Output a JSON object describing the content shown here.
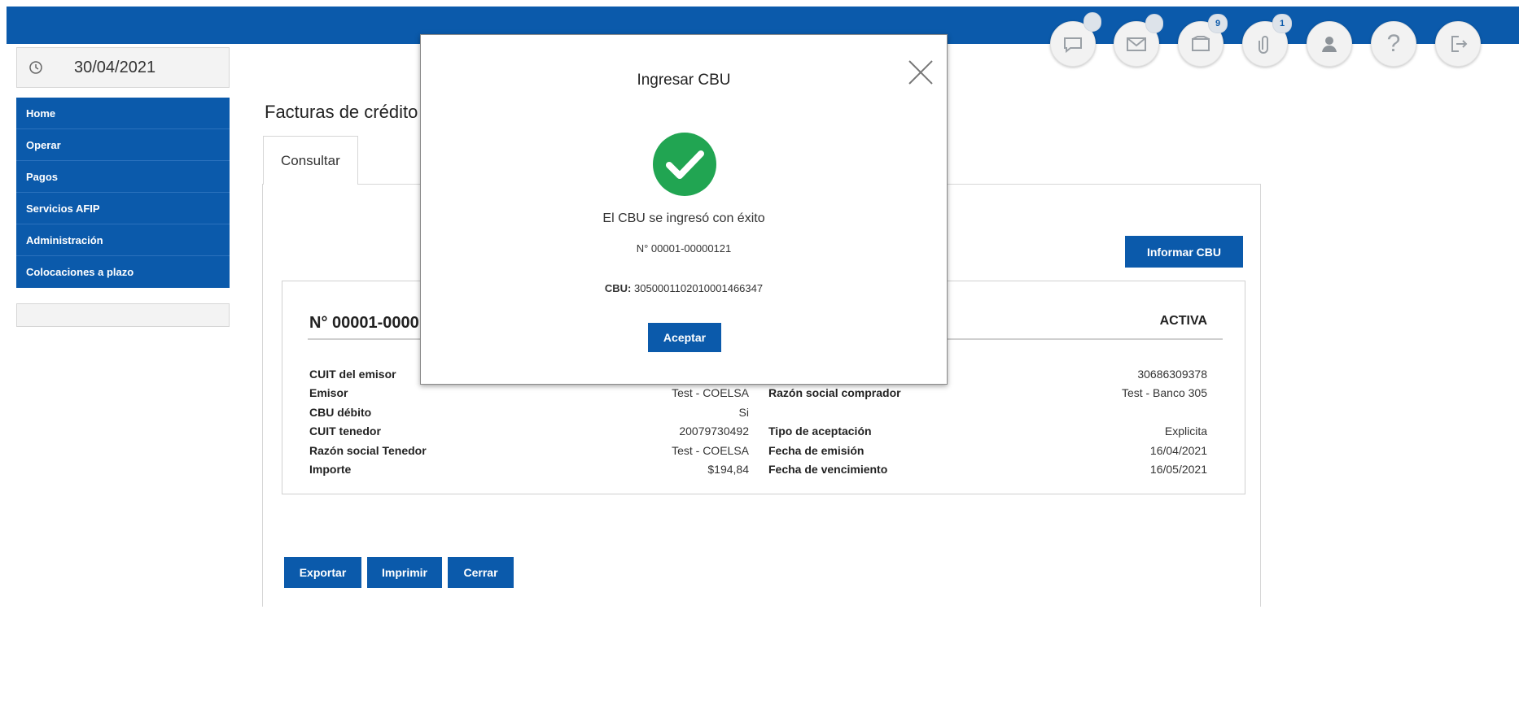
{
  "header": {
    "icons": [
      {
        "name": "chat-icon",
        "badge": ""
      },
      {
        "name": "mail-icon",
        "badge": ""
      },
      {
        "name": "tray-icon",
        "badge": "9"
      },
      {
        "name": "paperclip-icon",
        "badge": "1"
      },
      {
        "name": "user-icon",
        "badge": ""
      },
      {
        "name": "help-icon",
        "badge": ""
      },
      {
        "name": "logout-icon",
        "badge": ""
      }
    ],
    "help_glyph": "?"
  },
  "sidebar": {
    "date": "30/04/2021",
    "items": [
      {
        "label": "Home"
      },
      {
        "label": "Operar"
      },
      {
        "label": "Pagos"
      },
      {
        "label": "Servicios AFIP"
      },
      {
        "label": "Administración"
      },
      {
        "label": "Colocaciones a plazo"
      }
    ]
  },
  "main": {
    "title": "Facturas de crédito",
    "tab_label": "Consultar",
    "informar_cbu_label": "Informar CBU",
    "card": {
      "number": "N° 00001-0000",
      "status": "ACTIVA",
      "left_rows": [
        {
          "label": "CUIT del emisor",
          "value": ""
        },
        {
          "label": "Emisor",
          "value": "Test - COELSA"
        },
        {
          "label": "CBU débito",
          "value": "Si"
        },
        {
          "label": "CUIT tenedor",
          "value": "20079730492"
        },
        {
          "label": "Razón social Tenedor",
          "value": "Test - COELSA"
        },
        {
          "label": "Importe",
          "value": "$194,84"
        }
      ],
      "right_rows": [
        {
          "label": "",
          "value": "30686309378"
        },
        {
          "label": "Razón social comprador",
          "value": "Test - Banco 305"
        },
        {
          "label": "",
          "value": ""
        },
        {
          "label": "Tipo de aceptación",
          "value": "Explicita"
        },
        {
          "label": "Fecha de emisión",
          "value": "16/04/2021"
        },
        {
          "label": "Fecha de vencimiento",
          "value": "16/05/2021"
        }
      ]
    },
    "footer_buttons": {
      "export": "Exportar",
      "print": "Imprimir",
      "close": "Cerrar"
    }
  },
  "modal": {
    "title": "Ingresar CBU",
    "message": "El CBU se ingresó con éxito",
    "number": "N° 00001-00000121",
    "cbu_label": "CBU:",
    "cbu_value": "3050001102010001466347",
    "accept_label": "Aceptar",
    "success_color": "#21a552"
  }
}
